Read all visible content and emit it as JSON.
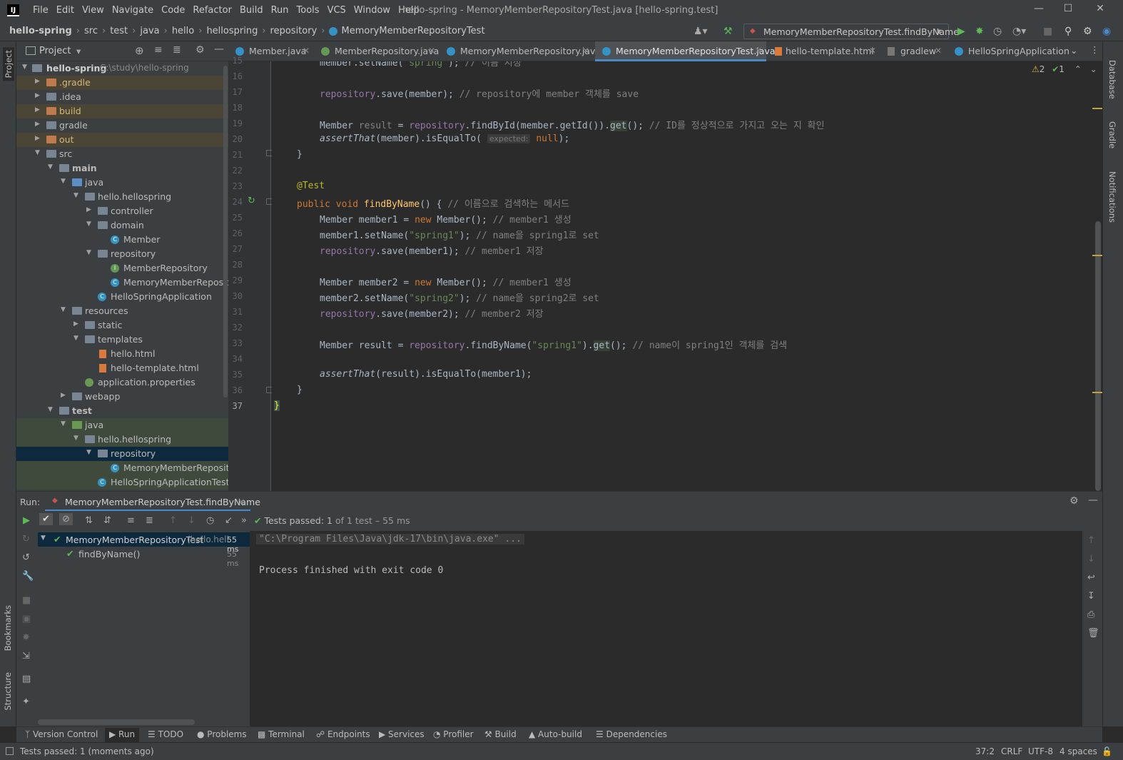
{
  "window": {
    "title": "hello-spring - MemoryMemberRepositoryTest.java [hello-spring.test]",
    "menu": [
      "File",
      "Edit",
      "View",
      "Navigate",
      "Code",
      "Refactor",
      "Build",
      "Run",
      "Tools",
      "VCS",
      "Window",
      "Help"
    ]
  },
  "breadcrumbs": [
    "hello-spring",
    "src",
    "test",
    "java",
    "hello",
    "hellospring",
    "repository",
    "MemoryMemberRepositoryTest"
  ],
  "run_config": "MemoryMemberRepositoryTest.findByName",
  "project": {
    "header": "Project",
    "root": "hello-spring",
    "root_path": "C:\\study\\hello-spring",
    "nodes": [
      {
        "label": ".gradle"
      },
      {
        "label": ".idea"
      },
      {
        "label": "build"
      },
      {
        "label": "gradle"
      },
      {
        "label": "out"
      },
      {
        "label": "src"
      },
      {
        "label": "main"
      },
      {
        "label": "java"
      },
      {
        "label": "hello.hellospring"
      },
      {
        "label": "controller"
      },
      {
        "label": "domain"
      },
      {
        "label": "Member"
      },
      {
        "label": "repository"
      },
      {
        "label": "MemberRepository"
      },
      {
        "label": "MemoryMemberRepository"
      },
      {
        "label": "HelloSpringApplication"
      },
      {
        "label": "resources"
      },
      {
        "label": "static"
      },
      {
        "label": "templates"
      },
      {
        "label": "hello.html"
      },
      {
        "label": "hello-template.html"
      },
      {
        "label": "application.properties"
      },
      {
        "label": "webapp"
      },
      {
        "label": "test"
      },
      {
        "label": "java"
      },
      {
        "label": "hello.hellospring"
      },
      {
        "label": "repository"
      },
      {
        "label": "MemoryMemberRepository"
      },
      {
        "label": "HelloSpringApplicationTests"
      }
    ]
  },
  "tabs": [
    {
      "label": "Member.java"
    },
    {
      "label": "MemberRepository.java"
    },
    {
      "label": "MemoryMemberRepository.java"
    },
    {
      "label": "MemoryMemberRepositoryTest.java"
    },
    {
      "label": "hello-template.html"
    },
    {
      "label": "gradlew"
    },
    {
      "label": "HelloSpringApplication.jav"
    }
  ],
  "inspections": {
    "warnings": "2",
    "ok": "1"
  },
  "editor": {
    "line_numbers": [
      "15",
      "16",
      "17",
      "18",
      "19",
      "20",
      "21",
      "22",
      "23",
      "24",
      "25",
      "26",
      "27",
      "28",
      "29",
      "30",
      "31",
      "32",
      "33",
      "34",
      "35",
      "36",
      "37"
    ],
    "hint_expected": "expected:"
  },
  "run": {
    "label": "Run:",
    "tab": "MemoryMemberRepositoryTest.findByName",
    "status_prefix": "Tests passed:",
    "status_count": "1",
    "status_suffix": "of 1 test – 55 ms",
    "tree": [
      {
        "label": "MemoryMemberRepositoryTest",
        "detail": "(hello.hell",
        "time": "55 ms"
      },
      {
        "label": "findByName()",
        "time": "55 ms"
      }
    ],
    "console": [
      "\"C:\\Program Files\\Java\\jdk-17\\bin\\java.exe\" ...",
      "",
      "Process finished with exit code 0"
    ]
  },
  "bottom_tools": [
    "Version Control",
    "Run",
    "TODO",
    "Problems",
    "Terminal",
    "Endpoints",
    "Services",
    "Profiler",
    "Build",
    "Auto-build",
    "Dependencies"
  ],
  "left_strip": [
    "Project",
    "Bookmarks",
    "Structure"
  ],
  "right_strip": [
    "Database",
    "Gradle",
    "Notifications"
  ],
  "status": {
    "message": "Tests passed: 1 (moments ago)",
    "position": "37:2",
    "line_sep": "CRLF",
    "encoding": "UTF-8",
    "indent": "4 spaces"
  },
  "colors": {
    "accent": "#4a88c7",
    "pass": "#5fb857",
    "bg": "#2b2b2b",
    "panel": "#3c3f41"
  }
}
